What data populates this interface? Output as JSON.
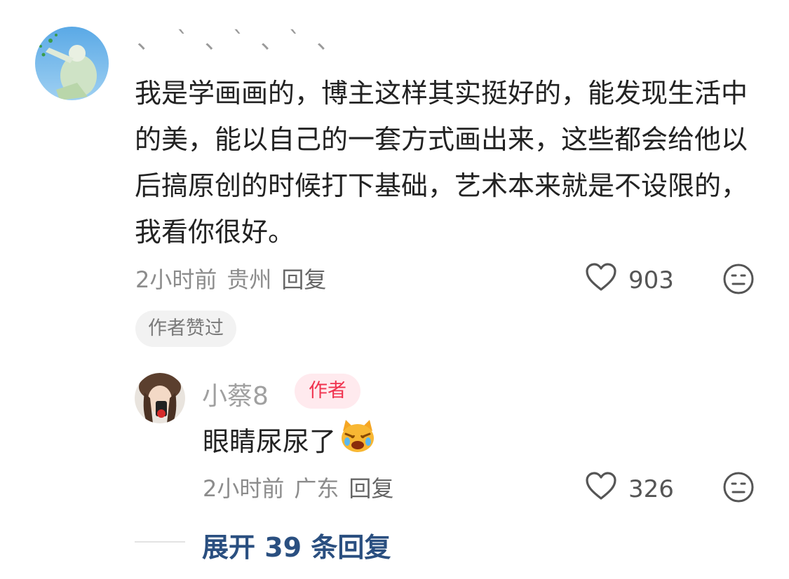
{
  "comment": {
    "username": "、 ˋ 、ˋ 、ˋ 、",
    "text": "我是学画画的，博主这样其实挺好的，能发现生活中的美，能以自己的一套方式画出来，这些都会给他以后搞原创的时候打下基础，艺术本来就是不设限的，我看你很好。",
    "time": "2小时前",
    "location": "贵州",
    "reply_label": "回复",
    "likes": "903",
    "author_liked": "作者赞过"
  },
  "reply": {
    "username": "小蔡8",
    "author_tag": "作者",
    "text": "眼睛尿尿了",
    "time": "2小时前",
    "location": "广东",
    "reply_label": "回复",
    "likes": "326"
  },
  "expand_label": "展开 39 条回复",
  "colors": {
    "expand_link": "#2a4f80",
    "author_tag_text": "#f0334f",
    "author_tag_bg": "#ffeaee"
  }
}
